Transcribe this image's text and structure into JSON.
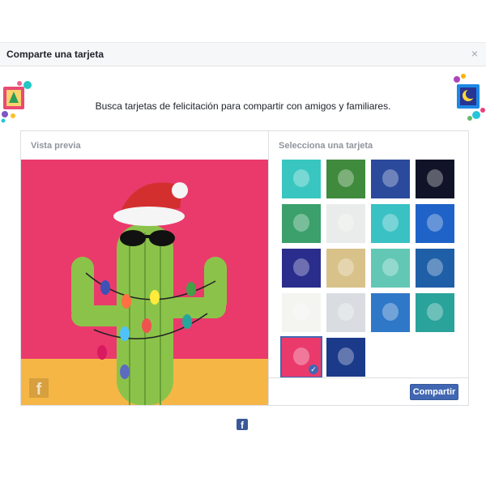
{
  "dialog": {
    "title": "Comparte una tarjeta",
    "close_symbol": "×"
  },
  "intro_text": "Busca tarjetas de felicitación para compartir con amigos y familiares.",
  "preview": {
    "label": "Vista previa"
  },
  "selector": {
    "label": "Selecciona una tarjeta",
    "cards": [
      {
        "name": "latte-art",
        "bg": "#39c6c0",
        "selected": false
      },
      {
        "name": "birds",
        "bg": "#3f8a3c",
        "selected": false
      },
      {
        "name": "moon-night",
        "bg": "#2b4a9c",
        "selected": false
      },
      {
        "name": "fireworks",
        "bg": "#111428",
        "selected": false
      },
      {
        "name": "van",
        "bg": "#3ba06c",
        "selected": false
      },
      {
        "name": "snowman",
        "bg": "#e9ecea",
        "selected": false
      },
      {
        "name": "candles",
        "bg": "#3ac1c4",
        "selected": false
      },
      {
        "name": "tree-ornaments",
        "bg": "#1f63c8",
        "selected": false
      },
      {
        "name": "sparkler",
        "bg": "#2a2d8c",
        "selected": false
      },
      {
        "name": "pattern",
        "bg": "#d8c28a",
        "selected": false
      },
      {
        "name": "snow-globe",
        "bg": "#63c7b6",
        "selected": false
      },
      {
        "name": "paper-stars",
        "bg": "#1e5fa8",
        "selected": false
      },
      {
        "name": "santa",
        "bg": "#f4f4f0",
        "selected": false
      },
      {
        "name": "angel",
        "bg": "#d9dde2",
        "selected": false
      },
      {
        "name": "rooftops",
        "bg": "#2f78c8",
        "selected": false
      },
      {
        "name": "christmas-tree",
        "bg": "#2aa39a",
        "selected": false
      },
      {
        "name": "cactus",
        "bg": "#ea3a6c",
        "selected": true
      },
      {
        "name": "forest",
        "bg": "#1b3a8a",
        "selected": false
      }
    ]
  },
  "share_button": "Compartir",
  "colors": {
    "accent": "#4267b2",
    "preview_pink": "#ea3a6c",
    "preview_floor": "#f5b646",
    "cactus_green": "#8bc34a"
  }
}
